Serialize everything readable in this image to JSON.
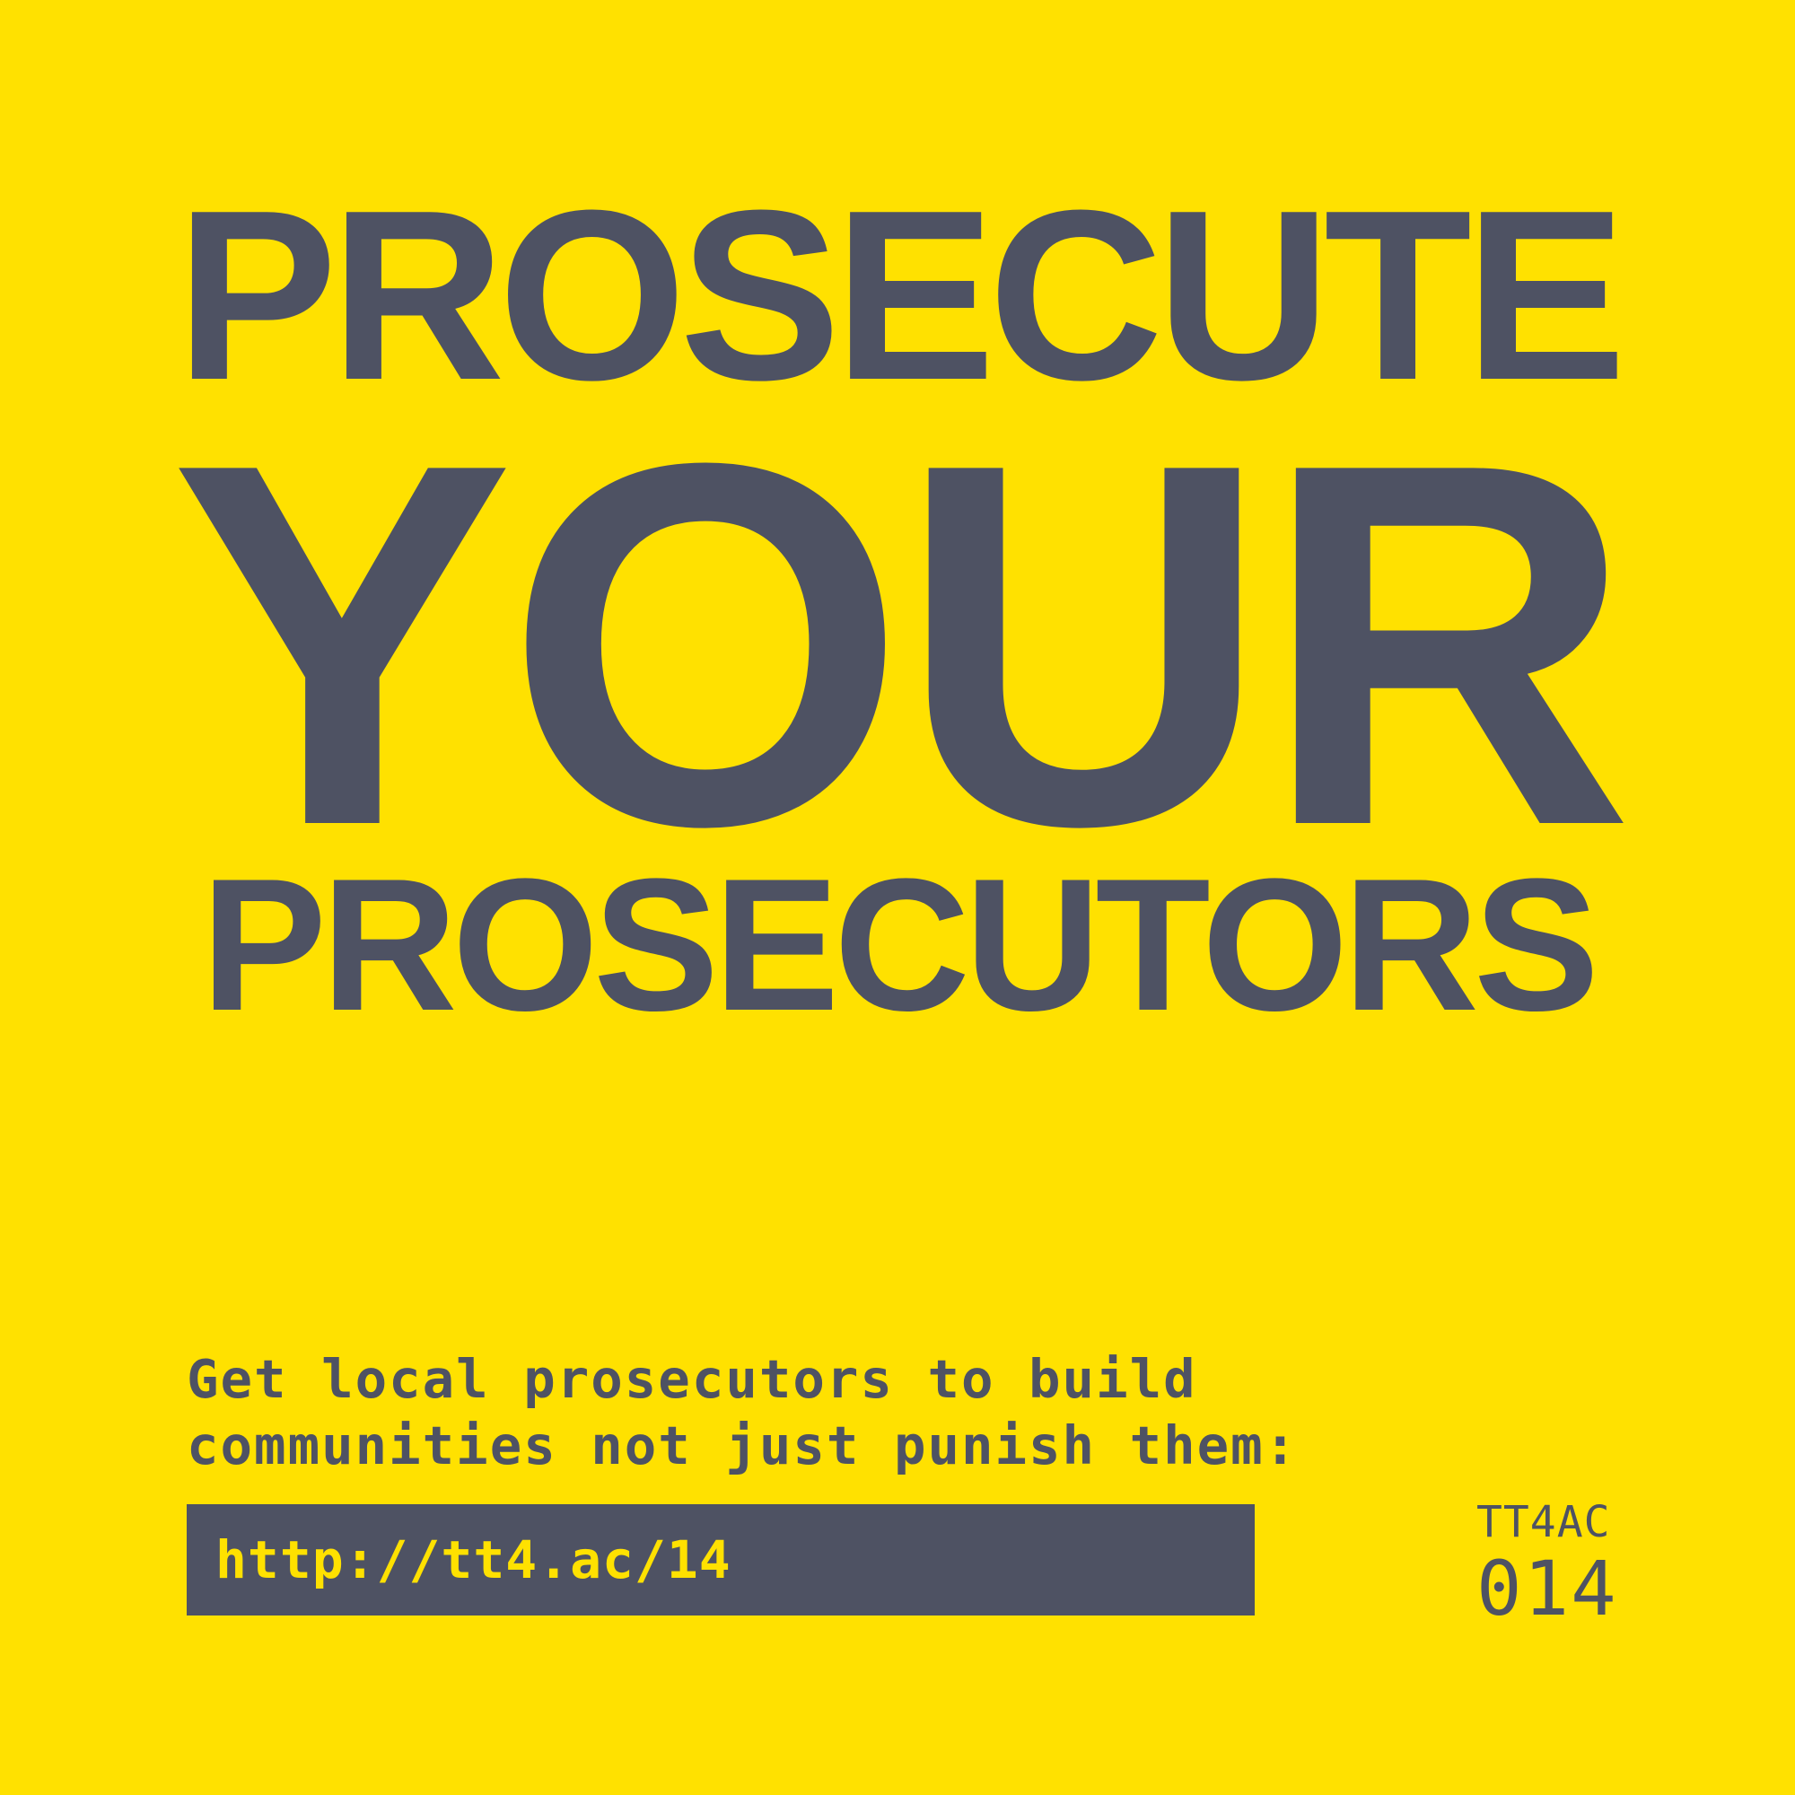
{
  "headline": {
    "line1": "PROSECUTE",
    "line2": "YOUR",
    "line3": "PROSECUTORS"
  },
  "subtext": {
    "line1": "Get local prosecutors to build",
    "line2": "communities not just punish them:"
  },
  "link": {
    "url": "http://tt4.ac/14"
  },
  "badge": {
    "code": "TT4AC",
    "number": "014"
  },
  "colors": {
    "background": "#FFE100",
    "text": "#4E5263",
    "link_box": "#4E5263",
    "link_text": "#FFE100"
  }
}
